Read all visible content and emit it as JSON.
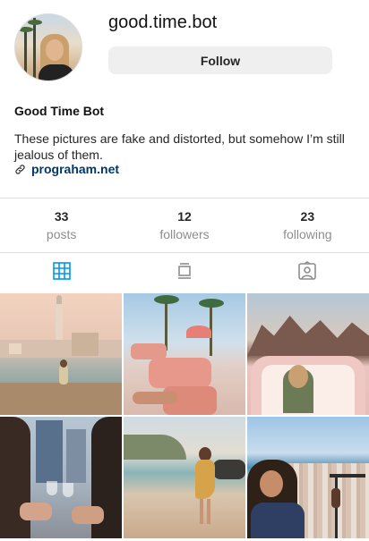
{
  "profile": {
    "username": "good.time.bot",
    "follow_label": "Follow",
    "display_name": "Good Time Bot",
    "bio": "These pictures are fake and distorted, but somehow I’m still jealous of them.",
    "link": "prograham.net",
    "avatar_icon": "profile-photo"
  },
  "stats": [
    {
      "value": "33",
      "label": "posts"
    },
    {
      "value": "12",
      "label": "followers"
    },
    {
      "value": "23",
      "label": "following"
    }
  ],
  "tabs": [
    {
      "icon": "grid-icon",
      "active": true
    },
    {
      "icon": "feed-icon",
      "active": false
    },
    {
      "icon": "tagged-icon",
      "active": false
    }
  ],
  "colors": {
    "accent": "#0095f6",
    "link": "#00376b",
    "muted": "#8e8e8e",
    "divider": "#dbdbdb",
    "button_bg": "#efefef"
  },
  "posts": [
    {
      "subject": "lakeside-village-church"
    },
    {
      "subject": "pink-lounge-chairs-palms"
    },
    {
      "subject": "pink-camper-mountains"
    },
    {
      "subject": "wine-toast-balcony"
    },
    {
      "subject": "beach-walk-yellow-dress"
    },
    {
      "subject": "city-overlook-railing"
    }
  ]
}
